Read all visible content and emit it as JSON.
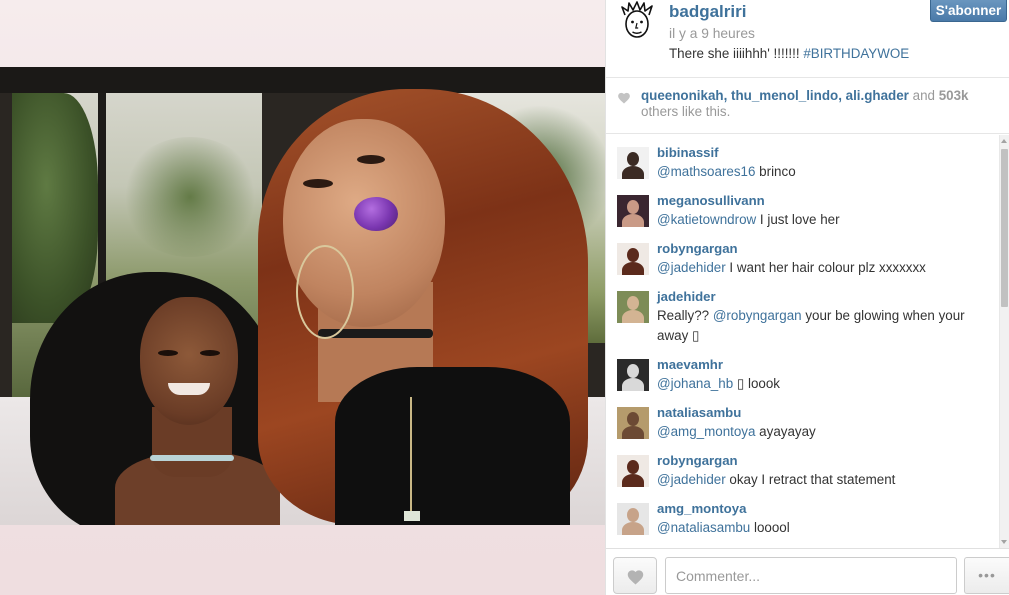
{
  "post": {
    "username": "badgalriri",
    "timestamp": "il y a 9 heures",
    "caption_text": "There she iiiihhh' !!!!!!!",
    "caption_hashtag": "#BIRTHDAYWOE",
    "follow_label": "S'abonner",
    "avatar_icon": "sketch-face-avatar"
  },
  "likes": {
    "icon": "heart-icon",
    "users": [
      "queenonikah",
      "thu_menol_lindo",
      "ali.ghader"
    ],
    "separator": ", ",
    "and_text": " and ",
    "count": "503k",
    "suffix": "others like this."
  },
  "comments": [
    {
      "username": "bibinassif",
      "avatar_bg": "#f1f1f1",
      "avatar_fg": "#3b2b24",
      "body": [
        {
          "text": "@mathsoares16",
          "mention": true
        },
        {
          "text": " brinco"
        }
      ]
    },
    {
      "username": "meganosullivann",
      "avatar_bg": "#3a2630",
      "avatar_fg": "#c99a86",
      "body": [
        {
          "text": "@katietowndrow",
          "mention": true
        },
        {
          "text": " I just love her"
        }
      ]
    },
    {
      "username": "robyngargan",
      "avatar_bg": "#efe9e4",
      "avatar_fg": "#5b2a1c",
      "body": [
        {
          "text": "@jadehider",
          "mention": true
        },
        {
          "text": " I want her hair colour plz xxxxxxx"
        }
      ]
    },
    {
      "username": "jadehider",
      "avatar_bg": "#7d8c57",
      "avatar_fg": "#d3b493",
      "body": [
        {
          "text": "Really?? "
        },
        {
          "text": "@robyngargan",
          "mention": true
        },
        {
          "text": " your be glowing when your away ▯"
        }
      ]
    },
    {
      "username": "maevamhr",
      "avatar_bg": "#2b2b2b",
      "avatar_fg": "#d9d9d9",
      "body": [
        {
          "text": "@johana_hb",
          "mention": true
        },
        {
          "text": " ▯ loook"
        }
      ]
    },
    {
      "username": "nataliasambu",
      "avatar_bg": "#b59b6c",
      "avatar_fg": "#6c4a34",
      "body": [
        {
          "text": "@amg_montoya",
          "mention": true
        },
        {
          "text": " ayayayay"
        }
      ]
    },
    {
      "username": "robyngargan",
      "avatar_bg": "#efe9e4",
      "avatar_fg": "#5b2a1c",
      "body": [
        {
          "text": "@jadehider",
          "mention": true
        },
        {
          "text": " okay I retract that statement"
        }
      ]
    },
    {
      "username": "amg_montoya",
      "avatar_bg": "#e6e6e6",
      "avatar_fg": "#c7a389",
      "body": [
        {
          "text": "@nataliasambu",
          "mention": true
        },
        {
          "text": " looool"
        }
      ]
    }
  ],
  "composer": {
    "like_icon": "heart-icon",
    "placeholder": "Commenter...",
    "more_label": "•••"
  },
  "colors": {
    "link": "#3f729b",
    "text": "#333333",
    "muted": "#999999",
    "follow_button": "#4a7aa8",
    "photo_background": "#f0e2e4"
  }
}
